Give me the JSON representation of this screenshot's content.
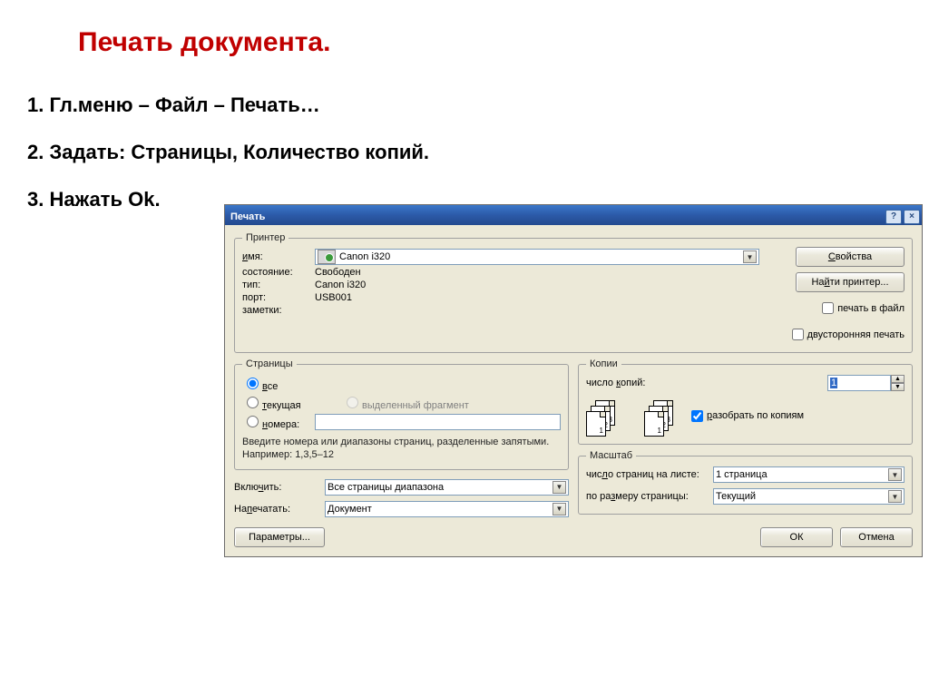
{
  "heading": "Печать документа.",
  "steps": {
    "s1": "1. Гл.меню – Файл – Печать…",
    "s2": "2. Задать: Страницы, Количество копий.",
    "s3": "3. Нажать Ok."
  },
  "dialog": {
    "title": "Печать",
    "help_icon": "?",
    "close_icon": "×",
    "printer": {
      "legend": "Принтер",
      "name_label": "имя:",
      "name_value": "Canon i320",
      "state_label": "состояние:",
      "state_value": "Свободен",
      "type_label": "тип:",
      "type_value": "Canon i320",
      "port_label": "порт:",
      "port_value": "USB001",
      "notes_label": "заметки:",
      "properties_btn": "Свойства",
      "find_printer_btn": "Найти принтер...",
      "to_file_chk": "печать в файл",
      "duplex_chk": "двусторонняя печать"
    },
    "pages": {
      "legend": "Страницы",
      "all": "все",
      "current": "текущая",
      "selection": "выделенный фрагмент",
      "numbers": "номера:",
      "hint": "Введите номера или диапазоны страниц, разделенные запятыми. Например: 1,3,5–12"
    },
    "copies": {
      "legend": "Копии",
      "count_label": "число копий:",
      "count_value": "1",
      "collate": "разобрать по копиям"
    },
    "include_label": "Включить:",
    "include_value": "Все страницы диапазона",
    "printwhat_label": "Напечатать:",
    "printwhat_value": "Документ",
    "zoom": {
      "legend": "Масштаб",
      "per_sheet_label": "число страниц на листе:",
      "per_sheet_value": "1 страница",
      "scale_label": "по размеру страницы:",
      "scale_value": "Текущий"
    },
    "params_btn": "Параметры...",
    "ok_btn": "ОК",
    "cancel_btn": "Отмена"
  }
}
